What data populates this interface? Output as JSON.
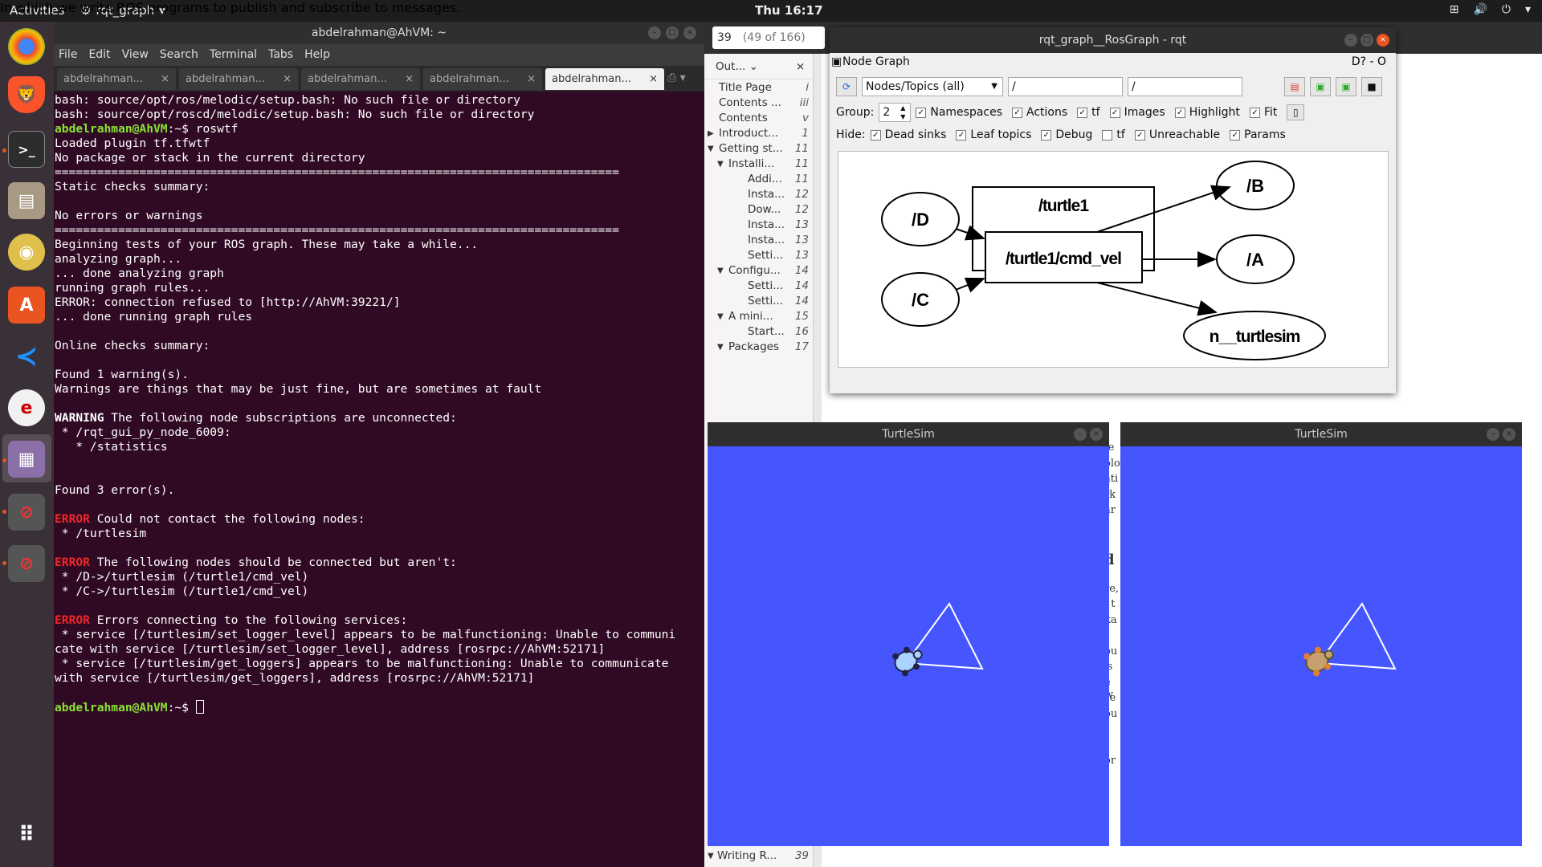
{
  "topbar": {
    "activities": "Activities",
    "app_name": "rqt_graph",
    "clock": "Thu 16:17"
  },
  "dock": {
    "items": [
      "chrome-icon",
      "brave-icon",
      "terminal-icon",
      "files-icon",
      "rhythmbox-icon",
      "software-icon",
      "vscode-icon",
      "evince-icon",
      "rqt-icon",
      "blocked-icon",
      "blocked-icon",
      "app-grid-icon"
    ]
  },
  "terminal": {
    "title": "abdelrahman@AhVM: ~",
    "menu": [
      "File",
      "Edit",
      "View",
      "Search",
      "Terminal",
      "Tabs",
      "Help"
    ],
    "tabs": [
      "abdelrahman...",
      "abdelrahman...",
      "abdelrahman...",
      "abdelrahman...",
      "abdelrahman..."
    ],
    "lines": [
      {
        "t": "bash: source/opt/ros/melodic/setup.bash: No such file or directory"
      },
      {
        "t": "bash: source/opt/roscd/melodic/setup.bash: No such file or directory"
      },
      {
        "p": "abdelrahman@AhVM",
        "t": ":~$ roswtf"
      },
      {
        "t": "Loaded plugin tf.tfwtf"
      },
      {
        "t": "No package or stack in the current directory"
      },
      {
        "t": "================================================================================"
      },
      {
        "t": "Static checks summary:"
      },
      {
        "t": ""
      },
      {
        "t": "No errors or warnings"
      },
      {
        "t": "================================================================================"
      },
      {
        "t": "Beginning tests of your ROS graph. These may take a while..."
      },
      {
        "t": "analyzing graph..."
      },
      {
        "t": "... done analyzing graph"
      },
      {
        "t": "running graph rules..."
      },
      {
        "t": "ERROR: connection refused to [http://AhVM:39221/]"
      },
      {
        "t": "... done running graph rules"
      },
      {
        "t": ""
      },
      {
        "t": "Online checks summary:"
      },
      {
        "t": ""
      },
      {
        "t": "Found 1 warning(s)."
      },
      {
        "t": "Warnings are things that may be just fine, but are sometimes at fault"
      },
      {
        "t": ""
      },
      {
        "b": "WARNING",
        "t": " The following node subscriptions are unconnected:"
      },
      {
        "t": " * /rqt_gui_py_node_6009:"
      },
      {
        "t": "   * /statistics"
      },
      {
        "t": ""
      },
      {
        "t": ""
      },
      {
        "t": "Found 3 error(s)."
      },
      {
        "t": ""
      },
      {
        "r": "ERROR",
        "t": " Could not contact the following nodes:"
      },
      {
        "t": " * /turtlesim"
      },
      {
        "t": ""
      },
      {
        "r": "ERROR",
        "t": " The following nodes should be connected but aren't:"
      },
      {
        "t": " * /D->/turtlesim (/turtle1/cmd_vel)"
      },
      {
        "t": " * /C->/turtlesim (/turtle1/cmd_vel)"
      },
      {
        "t": ""
      },
      {
        "r": "ERROR",
        "t": " Errors connecting to the following services:"
      },
      {
        "t": " * service [/turtlesim/set_logger_level] appears to be malfunctioning: Unable to communi"
      },
      {
        "t": "cate with service [/turtlesim/set_logger_level], address [rosrpc://AhVM:52171]"
      },
      {
        "t": " * service [/turtlesim/get_loggers] appears to be malfunctioning: Unable to communicate"
      },
      {
        "t": "with service [/turtlesim/get_loggers], address [rosrpc://AhVM:52171]"
      },
      {
        "t": ""
      },
      {
        "p": "abdelrahman@AhVM",
        "t": ":~$ ",
        "cursor": true
      }
    ]
  },
  "pdf": {
    "page_number": "39",
    "page_of": "(49 of 166)",
    "outline_header": "Out...",
    "outline": [
      {
        "label": "Title Page",
        "page": "i",
        "indent": 0,
        "arrow": ""
      },
      {
        "label": "Contents ...",
        "page": "iii",
        "indent": 0,
        "arrow": ""
      },
      {
        "label": "Contents",
        "page": "v",
        "indent": 0,
        "arrow": ""
      },
      {
        "label": "Introduct...",
        "page": "1",
        "indent": 0,
        "arrow": "▶"
      },
      {
        "label": "Getting st...",
        "page": "11",
        "indent": 0,
        "arrow": "▼"
      },
      {
        "label": "Installi...",
        "page": "11",
        "indent": 1,
        "arrow": "▼"
      },
      {
        "label": "Addi...",
        "page": "11",
        "indent": 2,
        "arrow": ""
      },
      {
        "label": "Insta...",
        "page": "12",
        "indent": 2,
        "arrow": ""
      },
      {
        "label": "Dow...",
        "page": "12",
        "indent": 2,
        "arrow": ""
      },
      {
        "label": "Insta...",
        "page": "13",
        "indent": 2,
        "arrow": ""
      },
      {
        "label": "Insta...",
        "page": "13",
        "indent": 2,
        "arrow": ""
      },
      {
        "label": "Setti...",
        "page": "13",
        "indent": 2,
        "arrow": ""
      },
      {
        "label": "Configu...",
        "page": "14",
        "indent": 1,
        "arrow": "▼"
      },
      {
        "label": "Setti...",
        "page": "14",
        "indent": 2,
        "arrow": ""
      },
      {
        "label": "Setti...",
        "page": "14",
        "indent": 2,
        "arrow": ""
      },
      {
        "label": "A mini...",
        "page": "15",
        "indent": 1,
        "arrow": "▼"
      },
      {
        "label": "Start...",
        "page": "16",
        "indent": 2,
        "arrow": ""
      },
      {
        "label": "Packages",
        "page": "17",
        "indent": 1,
        "arrow": "▼"
      }
    ],
    "outline_bottom": {
      "label": "Writing R...",
      "page": "39"
    },
    "caption": "In which we write ROS programs to publish and subscribe to messages.",
    "fragments": [
      "fe",
      "olo",
      "ati",
      "rk",
      "ar",
      "",
      "",
      "d",
      "",
      "re,",
      ", t",
      "ka",
      "",
      "ou",
      "'s",
      "e w",
      "se",
      "ou",
      "",
      "",
      "or"
    ]
  },
  "rqt": {
    "title": "rqt_graph__RosGraph - rqt",
    "panel_title": "Node Graph",
    "panel_controls": "D? - O",
    "mode": "Nodes/Topics (all)",
    "filter1": "/",
    "filter2": "/",
    "group_label": "Group:",
    "group_value": "2",
    "row1_checks": [
      {
        "label": "Namespaces",
        "checked": true
      },
      {
        "label": "Actions",
        "checked": true
      },
      {
        "label": "tf",
        "checked": true
      },
      {
        "label": "Images",
        "checked": true
      },
      {
        "label": "Highlight",
        "checked": true
      },
      {
        "label": "Fit",
        "checked": true
      }
    ],
    "hide_label": "Hide:",
    "row2_checks": [
      {
        "label": "Dead sinks",
        "checked": true
      },
      {
        "label": "Leaf topics",
        "checked": true
      },
      {
        "label": "Debug",
        "checked": true
      },
      {
        "label": "tf",
        "checked": false
      },
      {
        "label": "Unreachable",
        "checked": true
      },
      {
        "label": "Params",
        "checked": true
      }
    ],
    "graph": {
      "nodes": [
        "/D",
        "/C",
        "/B",
        "/A",
        "n__turtlesim"
      ],
      "namespace": "/turtle1",
      "topic": "/turtle1/cmd_vel"
    }
  },
  "turtlesim": {
    "title_left": "TurtleSim",
    "title_right": "TurtleSim",
    "bg_color": "#4556ff"
  }
}
